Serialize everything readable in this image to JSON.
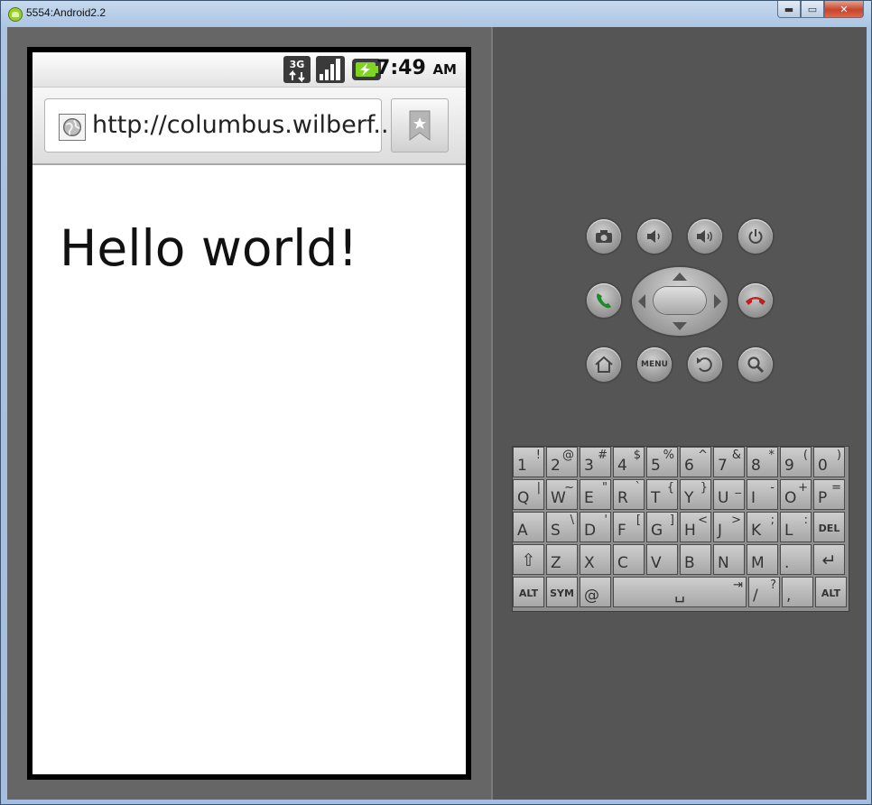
{
  "window": {
    "title": "5554:Android2.2",
    "minimize_glyph": "▬",
    "maximize_glyph": "▭",
    "close_glyph": "✕"
  },
  "status_bar": {
    "network_label": "3G",
    "time": "7:49",
    "am_pm": "AM"
  },
  "browser": {
    "url": "http://columbus.wilberf...",
    "page_heading": "Hello world!"
  },
  "controls": {
    "menu_label": "MENU"
  },
  "keyboard": {
    "rows": [
      [
        {
          "main": "1",
          "alt": "!"
        },
        {
          "main": "2",
          "alt": "@"
        },
        {
          "main": "3",
          "alt": "#"
        },
        {
          "main": "4",
          "alt": "$"
        },
        {
          "main": "5",
          "alt": "%"
        },
        {
          "main": "6",
          "alt": "^"
        },
        {
          "main": "7",
          "alt": "&"
        },
        {
          "main": "8",
          "alt": "*"
        },
        {
          "main": "9",
          "alt": "("
        },
        {
          "main": "0",
          "alt": ")"
        }
      ],
      [
        {
          "main": "Q",
          "alt": "|"
        },
        {
          "main": "W",
          "alt": "~"
        },
        {
          "main": "E",
          "alt": "\""
        },
        {
          "main": "R",
          "alt": "`"
        },
        {
          "main": "T",
          "alt": "{"
        },
        {
          "main": "Y",
          "alt": "}"
        },
        {
          "main": "U",
          "alt": "_"
        },
        {
          "main": "I",
          "alt": "-"
        },
        {
          "main": "O",
          "alt": "+"
        },
        {
          "main": "P",
          "alt": "="
        }
      ],
      [
        {
          "main": "A",
          "alt": ""
        },
        {
          "main": "S",
          "alt": "\\"
        },
        {
          "main": "D",
          "alt": "'"
        },
        {
          "main": "F",
          "alt": "["
        },
        {
          "main": "G",
          "alt": "]"
        },
        {
          "main": "H",
          "alt": "<"
        },
        {
          "main": "J",
          "alt": ">"
        },
        {
          "main": "K",
          "alt": ";"
        },
        {
          "main": "L",
          "alt": ":"
        },
        {
          "main": "DEL",
          "alt": ""
        }
      ],
      [
        {
          "main": "⇧",
          "alt": ""
        },
        {
          "main": "Z",
          "alt": ""
        },
        {
          "main": "X",
          "alt": ""
        },
        {
          "main": "C",
          "alt": ""
        },
        {
          "main": "V",
          "alt": ""
        },
        {
          "main": "B",
          "alt": ""
        },
        {
          "main": "N",
          "alt": ""
        },
        {
          "main": "M",
          "alt": ""
        },
        {
          "main": ".",
          "alt": ""
        },
        {
          "main": "↵",
          "alt": ""
        }
      ],
      [
        {
          "main": "ALT",
          "alt": ""
        },
        {
          "main": "SYM",
          "alt": ""
        },
        {
          "main": "@",
          "alt": ""
        },
        {
          "main": "␣",
          "alt": "⇥"
        },
        {
          "main": "/",
          "alt": "?"
        },
        {
          "main": ",",
          "alt": ""
        },
        {
          "main": "ALT",
          "alt": ""
        }
      ]
    ]
  }
}
